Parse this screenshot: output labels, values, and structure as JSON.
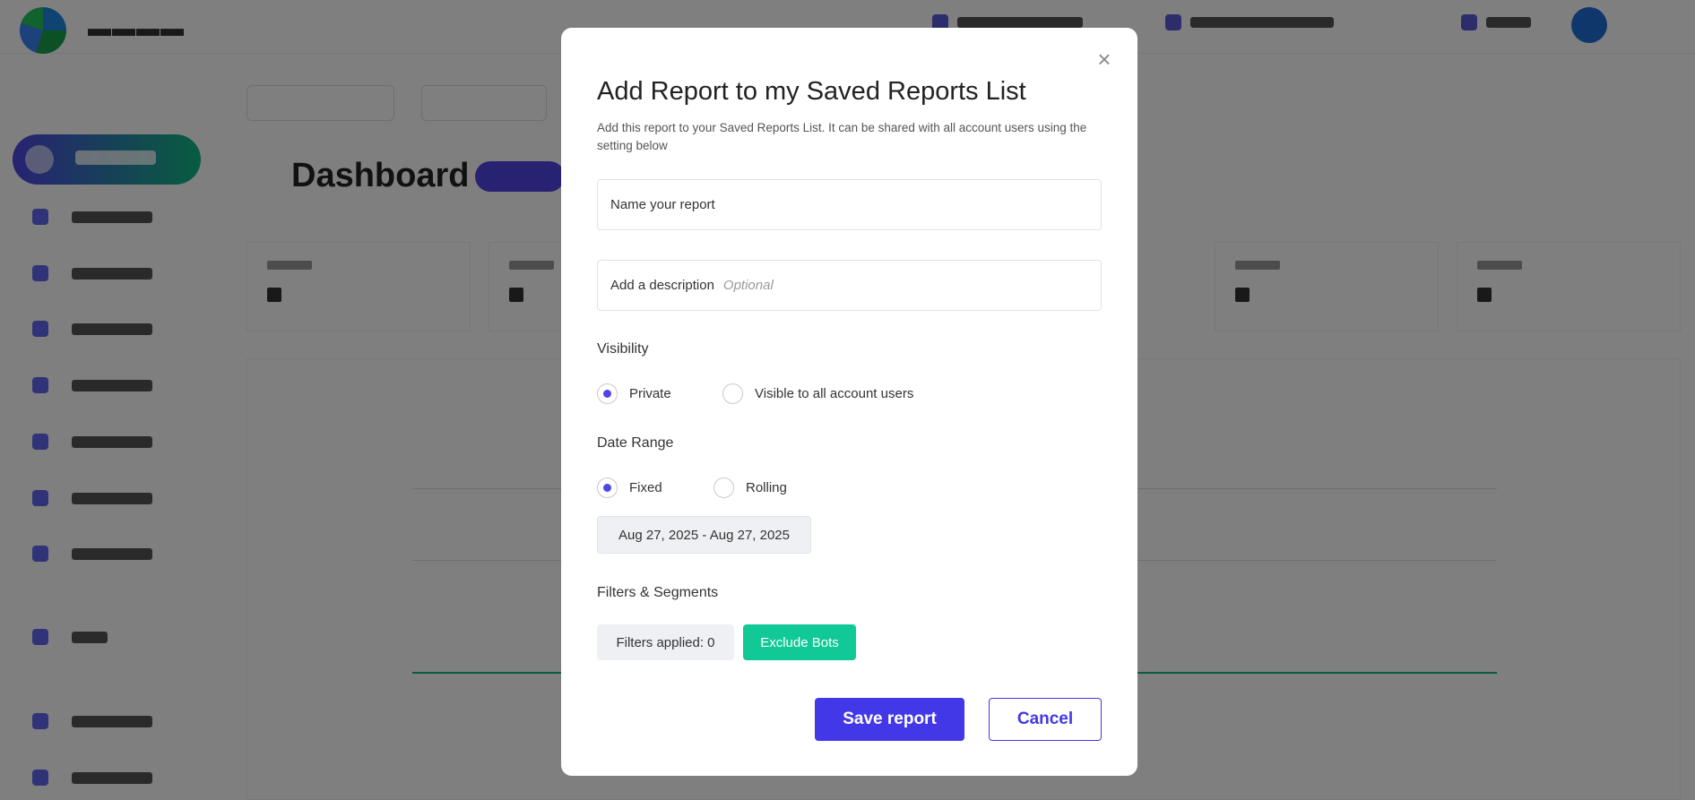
{
  "modal": {
    "close_icon": "close-icon",
    "title": "Add Report to my Saved Reports List",
    "description": "Add this report to your Saved Reports List. It can be shared with all account users using the setting below",
    "name_field": {
      "placeholder": "Name your report",
      "value": ""
    },
    "description_field": {
      "label": "Add a description",
      "hint": "Optional",
      "value": ""
    },
    "visibility": {
      "label": "Visibility",
      "options": [
        {
          "label": "Private",
          "selected": true
        },
        {
          "label": "Visible to all account users",
          "selected": false
        }
      ]
    },
    "date_range": {
      "label": "Date Range",
      "options": [
        {
          "label": "Fixed",
          "selected": true
        },
        {
          "label": "Rolling",
          "selected": false
        }
      ],
      "value": "Aug 27, 2025 - Aug 27, 2025"
    },
    "filters": {
      "label": "Filters & Segments",
      "applied": "Filters applied: 0",
      "exclude_bots": "Exclude Bots"
    },
    "buttons": {
      "save": "Save report",
      "cancel": "Cancel"
    },
    "colors": {
      "primary": "#4338e8",
      "accent_green": "#10c996"
    }
  },
  "background": {
    "page_title": "Dashboard"
  }
}
